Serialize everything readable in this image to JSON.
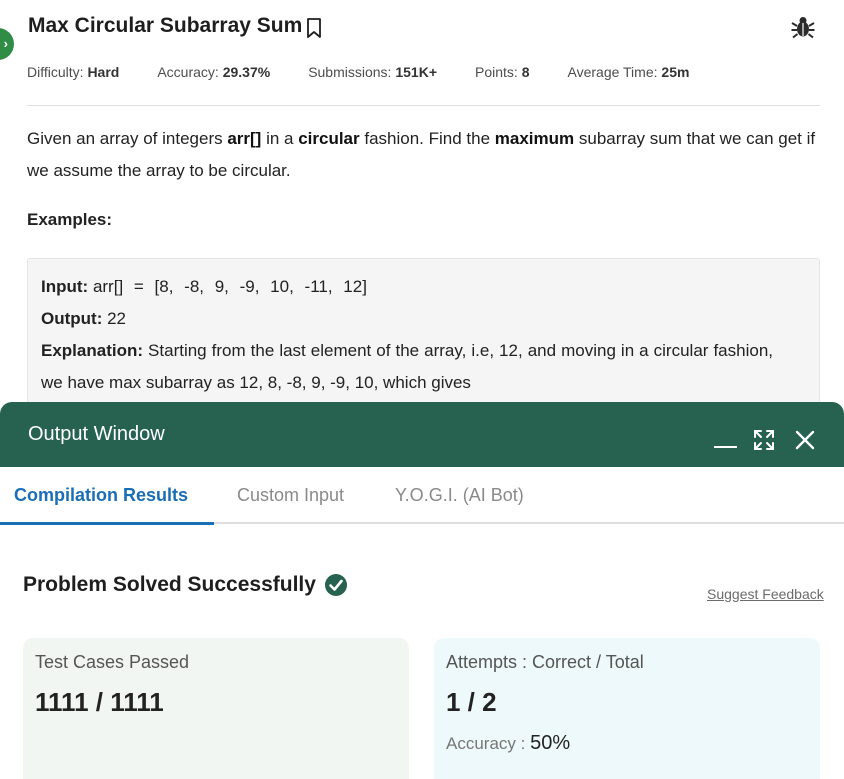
{
  "problem": {
    "title": "Max Circular Subarray Sum",
    "meta": [
      {
        "label": "Difficulty:",
        "value": "Hard"
      },
      {
        "label": "Accuracy:",
        "value": "29.37%"
      },
      {
        "label": "Submissions:",
        "value": "151K+"
      },
      {
        "label": "Points:",
        "value": "8"
      },
      {
        "label": "Average Time:",
        "value": "25m"
      }
    ],
    "description": {
      "p1": "Given an array of integers ",
      "b1": "arr[]",
      "p2": " in a ",
      "b2": "circular",
      "p3": " fashion. Find the ",
      "b3": "maximum",
      "p4": " subarray sum that we can get if we assume the array to be circular."
    },
    "examples_heading": "Examples:",
    "example": {
      "input_label": "Input:",
      "input_value": "arr[] = [8, -8, 9, -9, 10, -11, 12]",
      "output_label": "Output:",
      "output_value": "22",
      "explanation_label": "Explanation:",
      "explanation_value": "Starting from the last element of the array, i.e, 12, and moving in a circular fashion, we have max subarray as 12, 8, -8, 9, -9, 10, which gives"
    }
  },
  "output_window": {
    "title": "Output Window",
    "tabs": [
      {
        "label": "Compilation Results",
        "active": true
      },
      {
        "label": "Custom Input",
        "active": false
      },
      {
        "label": "Y.O.G.I. (AI Bot)",
        "active": false
      }
    ],
    "status": "Problem Solved Successfully",
    "feedback_link": "Suggest Feedback",
    "tests_card": {
      "label": "Test Cases Passed",
      "value": "1111 / 1111"
    },
    "attempts_card": {
      "label": "Attempts : Correct / Total",
      "value": "1 / 2",
      "accuracy_label": "Accuracy :",
      "accuracy_value": "50%"
    }
  },
  "colors": {
    "accent_green": "#2f8d46",
    "header_green": "#26624f",
    "tab_blue": "#1a6eb5"
  }
}
